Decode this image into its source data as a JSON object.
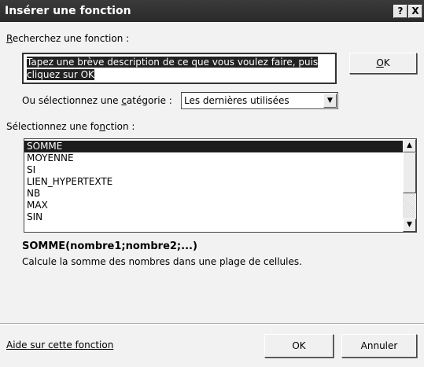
{
  "window": {
    "title": "Insérer une fonction",
    "help_btn": "?",
    "close_btn": "X"
  },
  "search": {
    "label": "Recherchez une fonction :",
    "description_line1": "Tapez une brève description de ce que vous voulez faire, puis",
    "description_line2": "cliquez sur OK",
    "ok_button": "OK"
  },
  "category": {
    "label": "Ou sélectionnez une catégorie :",
    "selected": "Les dernières utilisées"
  },
  "functions": {
    "label": "Sélectionnez une fonction :",
    "items": [
      "SOMME",
      "MOYENNE",
      "SI",
      "LIEN_HYPERTEXTE",
      "NB",
      "MAX",
      "SIN"
    ],
    "selected_index": 0
  },
  "details": {
    "signature": "SOMME(nombre1;nombre2;...)",
    "description": "Calcule la somme des nombres dans une plage de cellules."
  },
  "footer": {
    "help_link": "Aide sur cette fonction",
    "ok_button": "OK",
    "cancel_button": "Annuler"
  }
}
